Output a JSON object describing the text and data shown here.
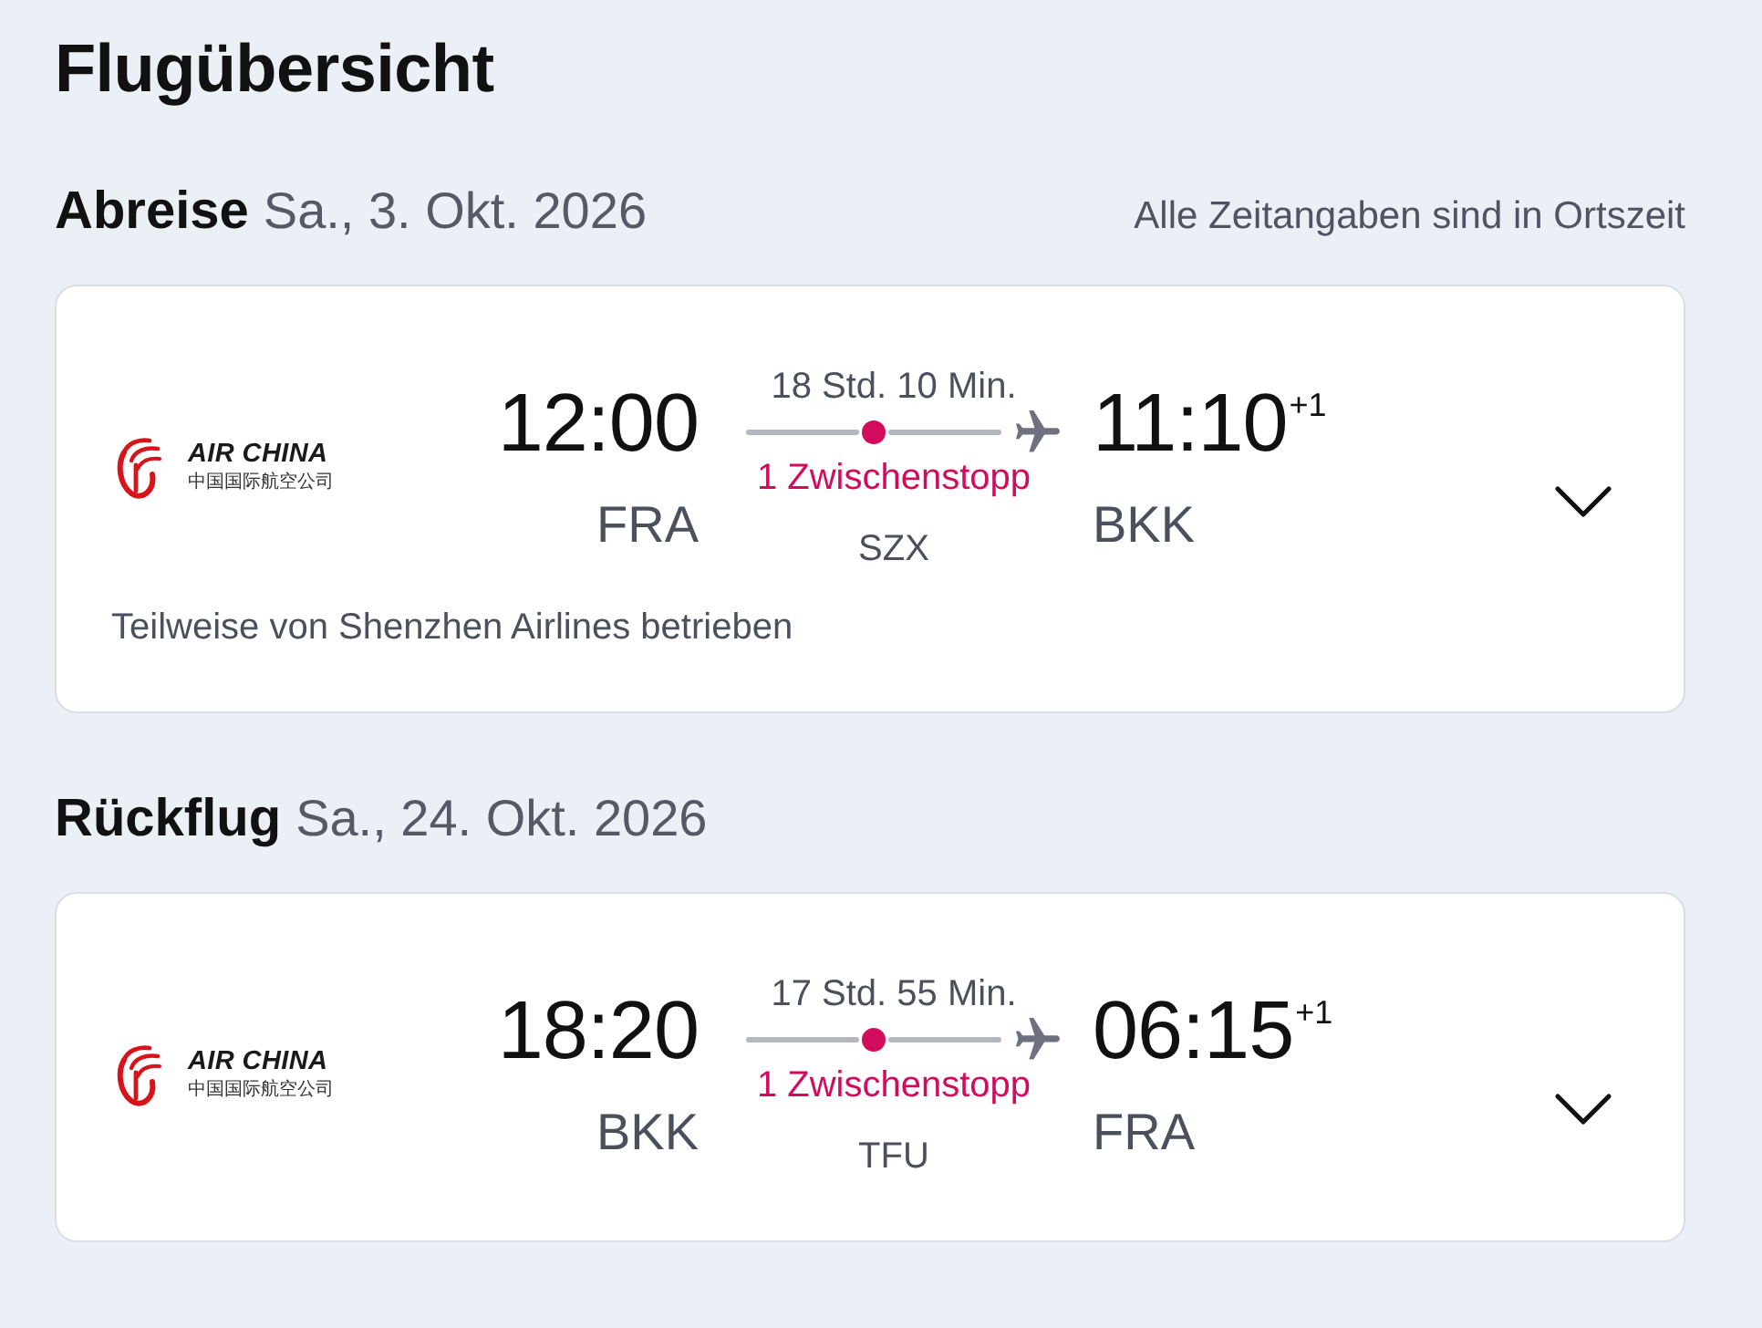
{
  "title": "Flugübersicht",
  "legs": [
    {
      "heading": "Abreise",
      "date": "Sa., 3. Okt. 2026",
      "side_note": "Alle Zeitangaben sind in Ortszeit",
      "airline": {
        "logo_text": "AIR CHINA",
        "logo_subtext": "中国国际航空公司"
      },
      "departure": {
        "time": "12:00",
        "airport": "FRA"
      },
      "duration": "18 Std. 10 Min.",
      "stops": "1 Zwischenstopp",
      "stopovers": [
        {
          "airport": "SZX"
        }
      ],
      "arrival": {
        "time": "11:10",
        "day_offset": "+1",
        "airport": "BKK"
      },
      "operator_note": "Teilweise von Shenzhen Airlines betrieben",
      "expanded": false
    },
    {
      "heading": "Rückflug",
      "date": "Sa., 24. Okt. 2026",
      "airline": {
        "logo_text": "AIR CHINA",
        "logo_subtext": "中国国际航空公司"
      },
      "departure": {
        "time": "18:20",
        "airport": "BKK"
      },
      "duration": "17 Std. 55 Min.",
      "stops": "1 Zwischenstopp",
      "stopovers": [
        {
          "airport": "TFU"
        }
      ],
      "arrival": {
        "time": "06:15",
        "day_offset": "+1",
        "airport": "FRA"
      },
      "expanded": false
    }
  ]
}
